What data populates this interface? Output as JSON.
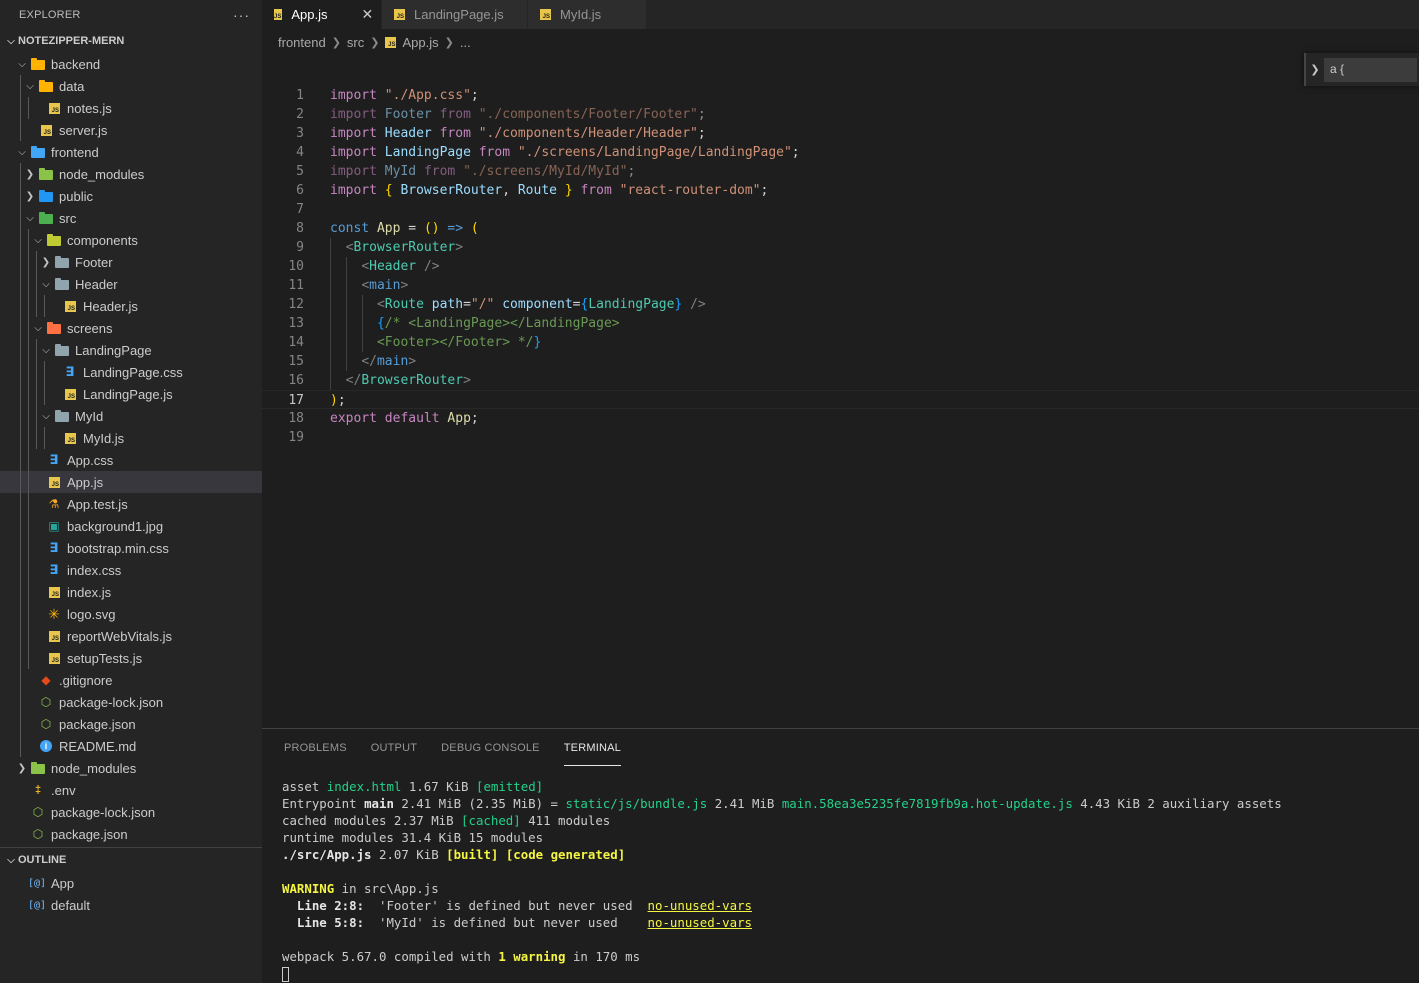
{
  "sidebar": {
    "title": "EXPLORER",
    "more": "···",
    "project": "NOTEZIPPER-MERN",
    "tree": [
      {
        "label": "backend",
        "depth": 1,
        "type": "folder",
        "open": true,
        "color": "#ffb300"
      },
      {
        "label": "data",
        "depth": 2,
        "type": "folder",
        "open": true,
        "color": "#ffb300"
      },
      {
        "label": "notes.js",
        "depth": 3,
        "type": "js"
      },
      {
        "label": "server.js",
        "depth": 2,
        "type": "js"
      },
      {
        "label": "frontend",
        "depth": 1,
        "type": "folder",
        "open": true,
        "color": "#42a5f5"
      },
      {
        "label": "node_modules",
        "depth": 2,
        "type": "folder",
        "open": false,
        "color": "#8bc34a"
      },
      {
        "label": "public",
        "depth": 2,
        "type": "folder",
        "open": false,
        "color": "#2196f3"
      },
      {
        "label": "src",
        "depth": 2,
        "type": "folder",
        "open": true,
        "color": "#4caf50"
      },
      {
        "label": "components",
        "depth": 3,
        "type": "folder",
        "open": true,
        "color": "#c0ca33"
      },
      {
        "label": "Footer",
        "depth": 4,
        "type": "folder",
        "open": false,
        "color": "#90a4ae"
      },
      {
        "label": "Header",
        "depth": 4,
        "type": "folder",
        "open": true,
        "color": "#90a4ae"
      },
      {
        "label": "Header.js",
        "depth": 5,
        "type": "js"
      },
      {
        "label": "screens",
        "depth": 3,
        "type": "folder",
        "open": true,
        "color": "#ff7043"
      },
      {
        "label": "LandingPage",
        "depth": 4,
        "type": "folder",
        "open": true,
        "color": "#90a4ae"
      },
      {
        "label": "LandingPage.css",
        "depth": 5,
        "type": "css"
      },
      {
        "label": "LandingPage.js",
        "depth": 5,
        "type": "js"
      },
      {
        "label": "MyId",
        "depth": 4,
        "type": "folder",
        "open": true,
        "color": "#90a4ae"
      },
      {
        "label": "MyId.js",
        "depth": 5,
        "type": "js"
      },
      {
        "label": "App.css",
        "depth": 3,
        "type": "css"
      },
      {
        "label": "App.js",
        "depth": 3,
        "type": "js",
        "selected": true
      },
      {
        "label": "App.test.js",
        "depth": 3,
        "type": "test"
      },
      {
        "label": "background1.jpg",
        "depth": 3,
        "type": "img"
      },
      {
        "label": "bootstrap.min.css",
        "depth": 3,
        "type": "css"
      },
      {
        "label": "index.css",
        "depth": 3,
        "type": "css"
      },
      {
        "label": "index.js",
        "depth": 3,
        "type": "js"
      },
      {
        "label": "logo.svg",
        "depth": 3,
        "type": "svg"
      },
      {
        "label": "reportWebVitals.js",
        "depth": 3,
        "type": "js"
      },
      {
        "label": "setupTests.js",
        "depth": 3,
        "type": "js"
      },
      {
        "label": ".gitignore",
        "depth": 2,
        "type": "git"
      },
      {
        "label": "package-lock.json",
        "depth": 2,
        "type": "json"
      },
      {
        "label": "package.json",
        "depth": 2,
        "type": "json"
      },
      {
        "label": "README.md",
        "depth": 2,
        "type": "info"
      },
      {
        "label": "node_modules",
        "depth": 1,
        "type": "folder",
        "open": false,
        "color": "#8bc34a"
      },
      {
        "label": ".env",
        "depth": 1,
        "type": "env"
      },
      {
        "label": "package-lock.json",
        "depth": 1,
        "type": "json"
      },
      {
        "label": "package.json",
        "depth": 1,
        "type": "json"
      }
    ],
    "outline_title": "OUTLINE",
    "outline": [
      {
        "label": "App",
        "icon": "[@]"
      },
      {
        "label": "default",
        "icon": "[@]"
      }
    ]
  },
  "tabs": [
    {
      "label": "App.js",
      "active": true,
      "close": "✕"
    },
    {
      "label": "LandingPage.js",
      "active": false
    },
    {
      "label": "MyId.js",
      "active": false
    }
  ],
  "breadcrumb": {
    "parts": [
      "frontend",
      "src",
      "App.js",
      "..."
    ]
  },
  "find": {
    "value": "a {"
  },
  "editor": {
    "current_line": 17,
    "lines": [
      [
        [
          "kw2",
          "import "
        ],
        [
          "str",
          "\"./App.css\""
        ],
        [
          "punc",
          ";"
        ]
      ],
      [
        [
          "kw2 dim",
          "import "
        ],
        [
          "var dim",
          "Footer "
        ],
        [
          "kw2 dim",
          "from "
        ],
        [
          "str dim",
          "\"./components/Footer/Footer\""
        ],
        [
          "punc dim",
          ";"
        ]
      ],
      [
        [
          "kw2",
          "import "
        ],
        [
          "var",
          "Header "
        ],
        [
          "kw2",
          "from "
        ],
        [
          "str",
          "\"./components/Header/Header\""
        ],
        [
          "punc",
          ";"
        ]
      ],
      [
        [
          "kw2",
          "import "
        ],
        [
          "var",
          "LandingPage "
        ],
        [
          "kw2",
          "from "
        ],
        [
          "str",
          "\"./screens/LandingPage/LandingPage\""
        ],
        [
          "punc",
          ";"
        ]
      ],
      [
        [
          "kw2 dim",
          "import "
        ],
        [
          "var dim",
          "MyId "
        ],
        [
          "kw2 dim",
          "from "
        ],
        [
          "str dim",
          "\"./screens/MyId/MyId\""
        ],
        [
          "punc dim",
          ";"
        ]
      ],
      [
        [
          "kw2",
          "import "
        ],
        [
          "b1",
          "{ "
        ],
        [
          "var",
          "BrowserRouter"
        ],
        [
          "punc",
          ", "
        ],
        [
          "var",
          "Route "
        ],
        [
          "b1",
          "} "
        ],
        [
          "kw2",
          "from "
        ],
        [
          "str",
          "\"react-router-dom\""
        ],
        [
          "punc",
          ";"
        ]
      ],
      [],
      [
        [
          "kw",
          "const "
        ],
        [
          "fn",
          "App "
        ],
        [
          "punc",
          "= "
        ],
        [
          "b1",
          "() "
        ],
        [
          "kw",
          "=> "
        ],
        [
          "b1",
          "("
        ]
      ],
      [
        [
          "punc",
          "  "
        ],
        [
          "brkt",
          "<"
        ],
        [
          "tag",
          "BrowserRouter"
        ],
        [
          "brkt",
          ">"
        ]
      ],
      [
        [
          "punc",
          "    "
        ],
        [
          "brkt",
          "<"
        ],
        [
          "tag",
          "Header "
        ],
        [
          "brkt",
          "/>"
        ]
      ],
      [
        [
          "punc",
          "    "
        ],
        [
          "brkt",
          "<"
        ],
        [
          "kw",
          "main"
        ],
        [
          "brkt",
          ">"
        ]
      ],
      [
        [
          "punc",
          "      "
        ],
        [
          "brkt",
          "<"
        ],
        [
          "tag",
          "Route "
        ],
        [
          "var",
          "path"
        ],
        [
          "punc",
          "="
        ],
        [
          "str",
          "\"/\" "
        ],
        [
          "var",
          "component"
        ],
        [
          "punc",
          "="
        ],
        [
          "b3",
          "{"
        ],
        [
          "tag",
          "LandingPage"
        ],
        [
          "b3",
          "}"
        ],
        [
          "brkt",
          " />"
        ]
      ],
      [
        [
          "punc",
          "      "
        ],
        [
          "b3",
          "{"
        ],
        [
          "cm",
          "/* <LandingPage></LandingPage>"
        ]
      ],
      [
        [
          "punc",
          "      "
        ],
        [
          "cm",
          "<Footer></Footer> */"
        ],
        [
          "b3",
          "}"
        ]
      ],
      [
        [
          "punc",
          "    "
        ],
        [
          "brkt",
          "</"
        ],
        [
          "kw",
          "main"
        ],
        [
          "brkt",
          ">"
        ]
      ],
      [
        [
          "punc",
          "  "
        ],
        [
          "brkt",
          "</"
        ],
        [
          "tag",
          "BrowserRouter"
        ],
        [
          "brkt",
          ">"
        ]
      ],
      [
        [
          "b1",
          ")"
        ],
        [
          "punc",
          ";"
        ]
      ],
      [
        [
          "kw2",
          "export "
        ],
        [
          "kw2",
          "default "
        ],
        [
          "fn",
          "App"
        ],
        [
          "punc",
          ";"
        ]
      ],
      []
    ]
  },
  "panel": {
    "tabs": [
      "PROBLEMS",
      "OUTPUT",
      "DEBUG CONSOLE",
      "TERMINAL"
    ],
    "active_tab": 3,
    "terminal": [
      [
        [
          "n",
          "asset "
        ],
        [
          "tg",
          "index.html"
        ],
        [
          "n",
          " 1.67 KiB "
        ],
        [
          "tg",
          "[emitted]"
        ]
      ],
      [
        [
          "n",
          "Entrypoint "
        ],
        [
          "tb",
          "main"
        ],
        [
          "n",
          " 2.41 MiB (2.35 MiB) = "
        ],
        [
          "tg",
          "static/js/bundle.js"
        ],
        [
          "n",
          " 2.41 MiB "
        ],
        [
          "tg",
          "main.58ea3e5235fe7819fb9a.hot-update.js"
        ],
        [
          "n",
          " 4.43 KiB 2 auxiliary assets"
        ]
      ],
      [
        [
          "n",
          "cached modules 2.37 MiB "
        ],
        [
          "tg",
          "[cached]"
        ],
        [
          "n",
          " 411 modules"
        ]
      ],
      [
        [
          "n",
          "runtime modules 31.4 KiB 15 modules"
        ]
      ],
      [
        [
          "tb",
          "./src/App.js"
        ],
        [
          "n",
          " 2.07 KiB "
        ],
        [
          "ty",
          "[built] [code generated]"
        ]
      ],
      [],
      [
        [
          "ty",
          "WARNING"
        ],
        [
          "n",
          " in src\\App.js"
        ]
      ],
      [
        [
          "n",
          "  "
        ],
        [
          "tb",
          "Line 2:8:"
        ],
        [
          "n",
          "  'Footer' is defined but never used  "
        ],
        [
          "tlink",
          "no-unused-vars"
        ]
      ],
      [
        [
          "n",
          "  "
        ],
        [
          "tb",
          "Line 5:8:"
        ],
        [
          "n",
          "  'MyId' is defined but never used    "
        ],
        [
          "tlink",
          "no-unused-vars"
        ]
      ],
      [],
      [
        [
          "n",
          "webpack 5.67.0 compiled with "
        ],
        [
          "ty",
          "1 warning"
        ],
        [
          "n",
          " in 170 ms"
        ]
      ]
    ]
  }
}
